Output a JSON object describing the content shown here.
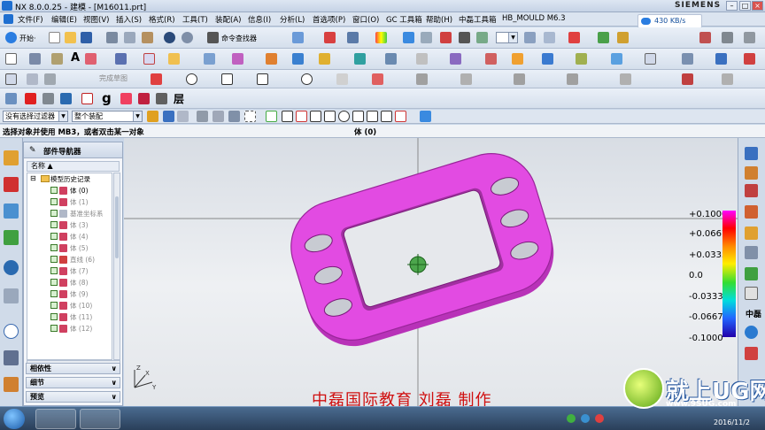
{
  "window": {
    "title": "NX 8.0.0.25 - 建模 - [M16011.prt]",
    "brand": "SIEMENS",
    "minimize": "–",
    "restore": "□",
    "close": "×"
  },
  "menu": {
    "items": [
      "文件(F)",
      "编辑(E)",
      "视图(V)",
      "插入(S)",
      "格式(R)",
      "工具(T)",
      "装配(A)",
      "信息(I)",
      "分析(L)",
      "首选项(P)",
      "窗口(O)",
      "GC 工具箱",
      "帮助(H)",
      "中磊工具箱",
      "HB_MOULD M6.3"
    ]
  },
  "net_speed": "430 KB/s",
  "toolbar": {
    "start_label": "开始·",
    "command_finder_label": "命令查找器",
    "layer_label": "层"
  },
  "filter": {
    "type_filter": "没有选择过滤器",
    "scope": "整个装配"
  },
  "cue": {
    "prompt": "选择对象并使用 MB3，或者双击某一对象",
    "status": "体 (0)"
  },
  "navigator": {
    "title": "部件导航器",
    "column": "名称",
    "root": "模型历史记录",
    "items": [
      {
        "label": "体 (0)",
        "icon": "body-icon"
      },
      {
        "label": "体 (1)",
        "icon": "body-icon"
      },
      {
        "label": "基准坐标系",
        "icon": "datum-csys-icon"
      },
      {
        "label": "体 (3)",
        "icon": "body-icon"
      },
      {
        "label": "体 (4)",
        "icon": "body-icon"
      },
      {
        "label": "体 (5)",
        "icon": "body-icon"
      },
      {
        "label": "直线 (6)",
        "icon": "line-icon"
      },
      {
        "label": "体 (7)",
        "icon": "body-icon"
      },
      {
        "label": "体 (8)",
        "icon": "body-icon"
      },
      {
        "label": "体 (9)",
        "icon": "body-icon"
      },
      {
        "label": "体 (10)",
        "icon": "body-icon"
      },
      {
        "label": "体 (11)",
        "icon": "body-icon"
      },
      {
        "label": "体 (12)",
        "icon": "body-icon"
      }
    ],
    "panels": [
      "相依性",
      "细节",
      "预览"
    ]
  },
  "legend": {
    "values": [
      "+0.1000",
      "+0.0667",
      "+0.0333",
      "0.0",
      "-0.0333",
      "-0.0667",
      "-0.1000"
    ]
  },
  "rightdock": {
    "label": "中磊"
  },
  "watermark": "中磊国际教育  刘磊  制作",
  "site": {
    "name": "就上UG网",
    "url": "www.9SUG.com"
  },
  "taskbar": {
    "date": "2016/11/2"
  },
  "colors": {
    "part": "#e24be2",
    "accent": "#1f6fd0"
  }
}
